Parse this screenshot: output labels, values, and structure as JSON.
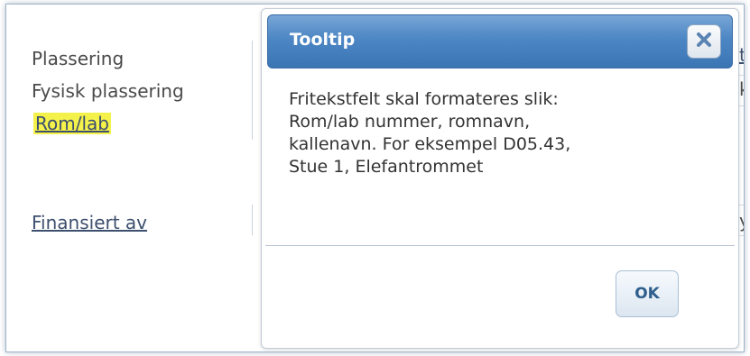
{
  "form": {
    "labels": {
      "plassering": "Plassering",
      "fysisk_plassering": "Fysisk plassering",
      "rom_lab": "Rom/lab",
      "finansiert_av": "Finansiert av"
    },
    "edge_fragments": {
      "row1": "t",
      "row2": "k",
      "row4": "y"
    },
    "highlight_color": "#f4f24a"
  },
  "dialog": {
    "title": "Tooltip",
    "close_icon": "close-x",
    "message_lines": [
      "Fritekstfelt skal formateres slik:",
      "Rom/lab nummer, romnavn,",
      "kallenavn. For eksempel D05.43,",
      "Stue 1, Elefantrommet"
    ],
    "ok_label": "OK",
    "titlebar_color": "#4c86c4"
  }
}
